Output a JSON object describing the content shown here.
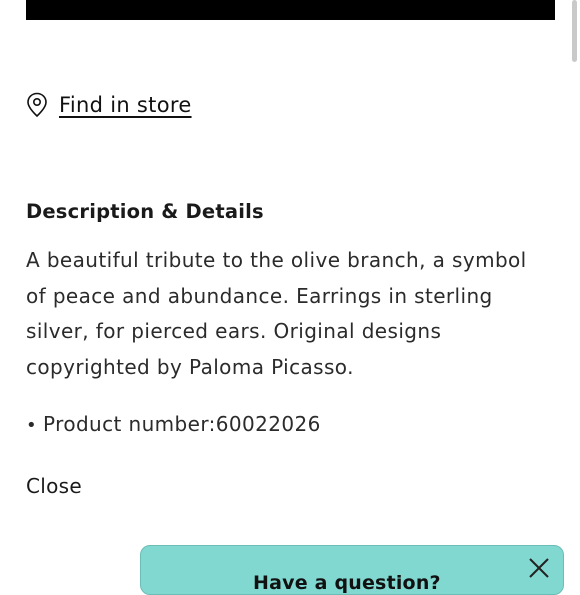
{
  "find_in_store": {
    "label": "Find in store",
    "icon": "location-pin-icon"
  },
  "description": {
    "title": "Description & Details",
    "body": "A beautiful tribute to the olive branch, a symbol of peace and abundance. Earrings in sterling silver, for pierced ears. Original designs copyrighted by Paloma Picasso.",
    "product_number_text": "Product number:60022026"
  },
  "close_label": "Close",
  "chat_widget": {
    "title": "Have a question?",
    "close_icon": "close-icon",
    "background_color": "#81d8d0"
  },
  "colors": {
    "brand_accent": "#81d8d0",
    "text": "#1a1a1a",
    "top_bar": "#000000"
  }
}
